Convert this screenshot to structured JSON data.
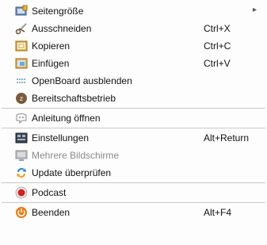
{
  "menu": {
    "items": [
      {
        "label": "Seitengröße",
        "shortcut": "",
        "submenu_arrow": "▸",
        "icon": "page-size-icon",
        "enabled": true
      },
      {
        "label": "Ausschneiden",
        "shortcut": "Ctrl+X",
        "icon": "scissors-icon",
        "enabled": true
      },
      {
        "label": "Kopieren",
        "shortcut": "Ctrl+C",
        "icon": "copy-icon",
        "enabled": true
      },
      {
        "label": "Einfügen",
        "shortcut": "Ctrl+V",
        "icon": "paste-icon",
        "enabled": true
      },
      {
        "label": "OpenBoard ausblenden",
        "shortcut": "",
        "icon": "hide-dots-icon",
        "enabled": true
      },
      {
        "label": "Bereitschaftsbetrieb",
        "shortcut": "",
        "icon": "standby-icon",
        "enabled": true
      },
      {
        "label": "Anleitung öffnen",
        "shortcut": "",
        "icon": "tutorial-icon",
        "enabled": true
      },
      {
        "label": "Einstellungen",
        "shortcut": "Alt+Return",
        "icon": "settings-icon",
        "enabled": true
      },
      {
        "label": "Mehrere Bildschirme",
        "shortcut": "",
        "icon": "monitor-icon",
        "enabled": false
      },
      {
        "label": "Update überprüfen",
        "shortcut": "",
        "icon": "update-icon",
        "enabled": true
      },
      {
        "label": "Podcast",
        "shortcut": "",
        "icon": "record-icon",
        "enabled": true
      },
      {
        "label": "Beenden",
        "shortcut": "Alt+F4",
        "icon": "power-icon",
        "enabled": true
      }
    ]
  },
  "colors": {
    "record_red": "#d61f1f",
    "power_orange": "#f07a10",
    "update_blue": "#2f86d6",
    "disabled_text": "#8a8a8a"
  }
}
